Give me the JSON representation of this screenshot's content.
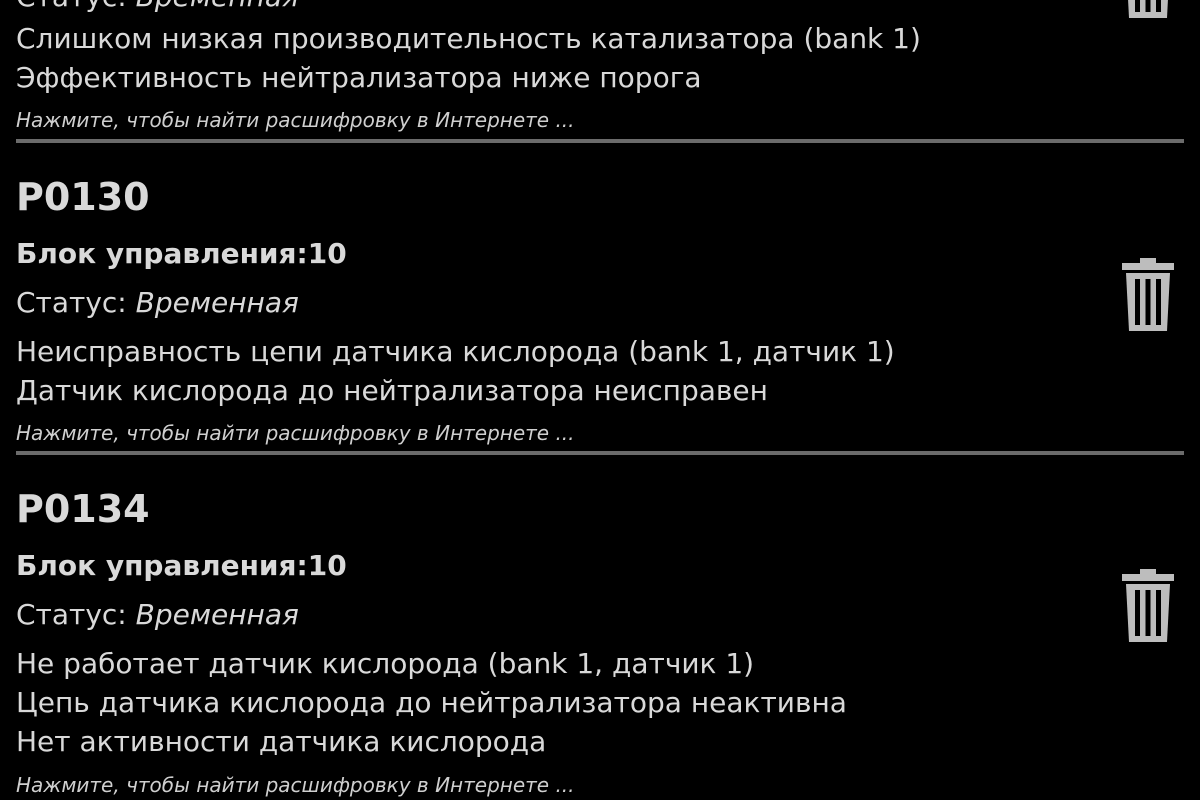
{
  "entries": [
    {
      "code": "",
      "status_label": "Статус: ",
      "status_value": "Временная",
      "lines": [
        "Слишком низкая производительность катализатора (bank 1)",
        "Эффективность нейтрализатора ниже порога"
      ],
      "hint": "Нажмите, чтобы найти расшифровку в Интернете ..."
    },
    {
      "code": "P0130",
      "ecu": "Блок управления:10",
      "status_label": "Статус: ",
      "status_value": "Временная",
      "lines": [
        "Неисправность цепи датчика кислорода (bank 1, датчик 1)",
        "Датчик кислорода до нейтрализатора неисправен"
      ],
      "hint": "Нажмите, чтобы найти расшифровку в Интернете ..."
    },
    {
      "code": "P0134",
      "ecu": "Блок управления:10",
      "status_label": "Статус: ",
      "status_value": "Временная",
      "lines": [
        "Не работает датчик кислорода (bank 1, датчик 1)",
        "Цепь датчика кислорода до нейтрализатора неактивна",
        "Нет активности датчика кислорода"
      ],
      "hint": "Нажмите, чтобы найти расшифровку в Интернете ..."
    }
  ],
  "icons": {
    "delete": "trash-icon"
  },
  "colors": {
    "background": "#000000",
    "text": "#d9d9d9",
    "divider": "#6b6b6b",
    "icon": "#bdbdbd"
  }
}
